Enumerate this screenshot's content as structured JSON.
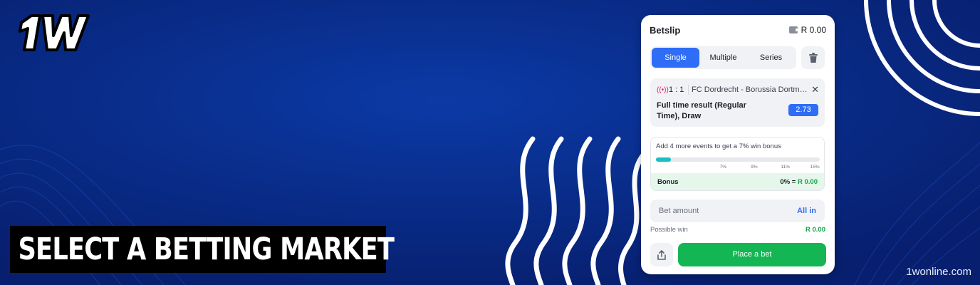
{
  "brand": {
    "logo_text": "1W",
    "site": "1wonline.com"
  },
  "caption": "SELECT A BETTING MARKET",
  "colors": {
    "background": "#0a2a8c",
    "accent": "#2f6df6",
    "success": "#14b654",
    "live": "#e0245e"
  },
  "betslip": {
    "title": "Betslip",
    "balance": "R 0.00",
    "tabs": [
      {
        "label": "Single",
        "active": true
      },
      {
        "label": "Multiple",
        "active": false
      },
      {
        "label": "Series",
        "active": false
      }
    ],
    "event": {
      "score": "1 : 1",
      "match": "FC Dordrecht - Borussia Dortmund",
      "market": "Full time result (Regular Time), Draw",
      "odds": "2.73"
    },
    "bonus": {
      "text": "Add 4 more events to get a 7% win bonus",
      "progress": 0.09,
      "ticks": [
        "7%",
        "9%",
        "11%",
        "15%"
      ],
      "label": "Bonus",
      "percent": "0%",
      "equals": "=",
      "amount": "R 0.00"
    },
    "bet_amount_placeholder": "Bet amount",
    "all_in": "All in",
    "possible_win_label": "Possible win",
    "possible_win_value": "R 0.00",
    "place_bet": "Place a bet"
  }
}
